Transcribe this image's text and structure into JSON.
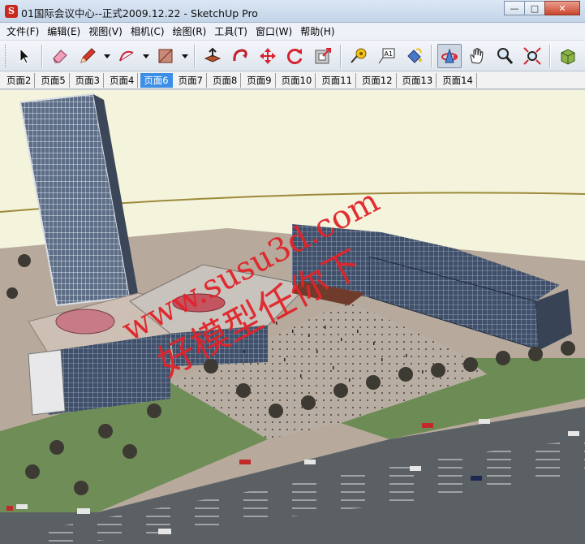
{
  "window": {
    "title": "01国际会议中心--正式2009.12.22 - SketchUp Pro",
    "minimize_glyph": "—",
    "maximize_glyph": "□",
    "close_glyph": "✕"
  },
  "menu": [
    {
      "label": "文件(F)"
    },
    {
      "label": "编辑(E)"
    },
    {
      "label": "视图(V)"
    },
    {
      "label": "相机(C)"
    },
    {
      "label": "绘图(R)"
    },
    {
      "label": "工具(T)"
    },
    {
      "label": "窗口(W)"
    },
    {
      "label": "帮助(H)"
    }
  ],
  "toolbar": {
    "tools": [
      "select-icon",
      "eraser-icon",
      "pencil-icon",
      "arc-icon",
      "rectangle-icon",
      "push-pull-icon",
      "follow-me-icon",
      "move-icon",
      "rotate-icon",
      "offset-icon",
      "tape-measure-icon",
      "text-label-icon",
      "paint-bucket-icon",
      "orbit-icon",
      "pan-icon",
      "zoom-icon",
      "zoom-extents-icon",
      "components-icon"
    ],
    "active_tool": "orbit-icon",
    "text_tool_glyph": "A1"
  },
  "scene_tabs": [
    {
      "label": "页面2"
    },
    {
      "label": "页面5"
    },
    {
      "label": "页面3"
    },
    {
      "label": "页面4"
    },
    {
      "label": "页面6",
      "active": true
    },
    {
      "label": "页面7"
    },
    {
      "label": "页面8"
    },
    {
      "label": "页面9"
    },
    {
      "label": "页面10"
    },
    {
      "label": "页面11"
    },
    {
      "label": "页面12"
    },
    {
      "label": "页面13"
    },
    {
      "label": "页面14"
    }
  ],
  "viewport": {
    "watermark_url": "www.susu3d.com",
    "watermark_slogan": "好模型任你下",
    "colors": {
      "sky": "#f4f3dc",
      "road": "#5a5f62",
      "grass": "#6e8c55",
      "plaza": "#b9aea3",
      "glass": "#3f4f62",
      "watermark": "#e0242a"
    }
  }
}
